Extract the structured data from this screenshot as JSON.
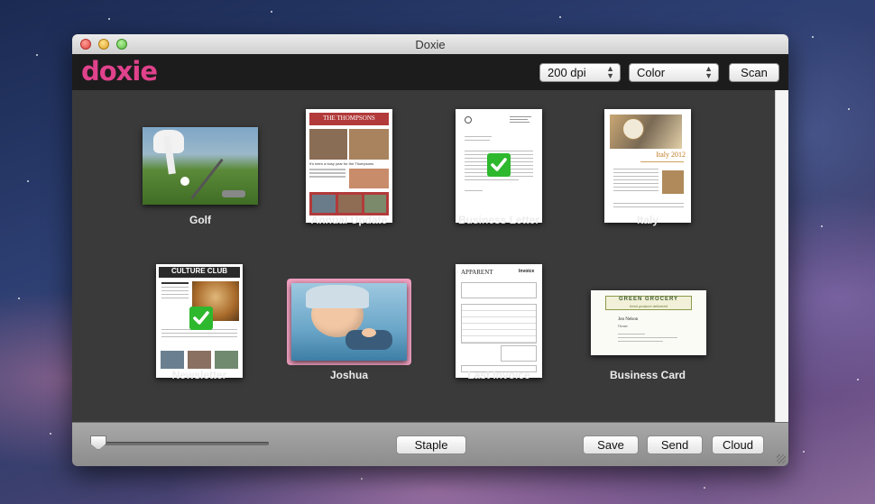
{
  "window": {
    "title": "Doxie"
  },
  "app": {
    "logo": "doxie"
  },
  "toolbar": {
    "resolution": "200 dpi",
    "color_mode": "Color",
    "scan_label": "Scan"
  },
  "documents": [
    {
      "label": "Golf",
      "checked": false,
      "selected": false
    },
    {
      "label": "Annual Update",
      "checked": false,
      "selected": false,
      "heading": "THE THOMPSONS",
      "subheading": "It's been a busy year for the Thompsons"
    },
    {
      "label": "Business Letter",
      "checked": true,
      "selected": false
    },
    {
      "label": "Italy",
      "checked": false,
      "selected": false,
      "heading": "Italy 2012"
    },
    {
      "label": "Newsletter",
      "checked": true,
      "selected": false,
      "heading": "CULTURE CLUB"
    },
    {
      "label": "Joshua",
      "checked": false,
      "selected": true
    },
    {
      "label": "Last Invoice",
      "checked": false,
      "selected": false,
      "heading": "APPARENT",
      "subheading": "Invoice"
    },
    {
      "label": "Business Card",
      "checked": false,
      "selected": false,
      "heading": "GREEN GROCERY",
      "subheading": "fresh produce delivered",
      "name": "Jon Nelson",
      "role": "Owner"
    }
  ],
  "bottom": {
    "staple_label": "Staple",
    "save_label": "Save",
    "send_label": "Send",
    "cloud_label": "Cloud",
    "zoom_level": 0.0
  },
  "colors": {
    "accent": "#e0428c",
    "check": "#2eb82e",
    "selection": "#f0a0c0",
    "content_bg": "#3a3a3a"
  }
}
